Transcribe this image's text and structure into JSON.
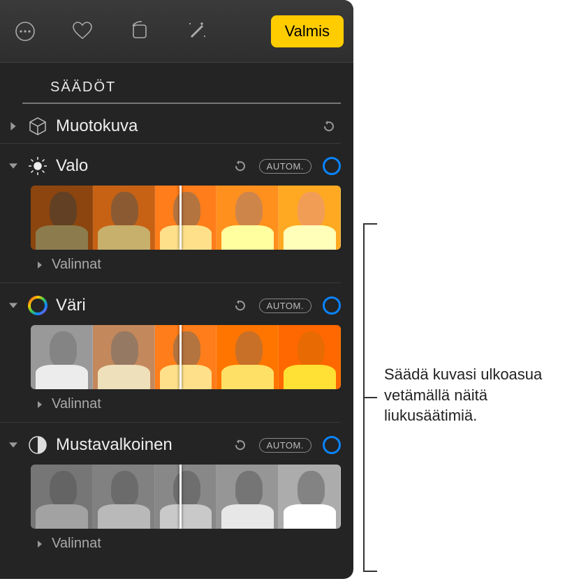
{
  "toolbar": {
    "done_label": "Valmis"
  },
  "section": {
    "title": "SÄÄDÖT"
  },
  "groups": {
    "portrait": {
      "label": "Muotokuva"
    },
    "light": {
      "label": "Valo",
      "auto": "AUTOM.",
      "options": "Valinnat"
    },
    "color": {
      "label": "Väri",
      "auto": "AUTOM.",
      "options": "Valinnat"
    },
    "bw": {
      "label": "Mustavalkoinen",
      "auto": "AUTOM.",
      "options": "Valinnat"
    }
  },
  "callout": {
    "text": "Säädä kuvasi ulkoasua vetämällä näitä liukusäätimiä."
  }
}
